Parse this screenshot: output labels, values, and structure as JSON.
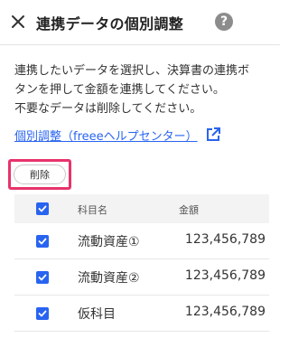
{
  "header": {
    "title": "連携データの個別調整",
    "help_symbol": "?"
  },
  "description": {
    "lines": [
      "連携したいデータを選択し、決算書の連携ボ",
      "タンを押して金額を連携してください。",
      "不要なデータは削除してください。"
    ]
  },
  "help_link": {
    "label": "個別調整（freeeヘルプセンター）"
  },
  "toolbar": {
    "delete_label": "削除"
  },
  "table": {
    "columns": {
      "name": "科目名",
      "amount": "金額"
    },
    "header_checked": true,
    "rows": [
      {
        "checked": true,
        "name": "流動資産①",
        "amount": "123,456,789"
      },
      {
        "checked": true,
        "name": "流動資産②",
        "amount": "123,456,789"
      },
      {
        "checked": true,
        "name": "仮科目",
        "amount": "123,456,789"
      }
    ]
  },
  "colors": {
    "accent": "#2864f0",
    "highlight": "#e8336b",
    "help_icon": "#8c8c8c"
  },
  "icons": {
    "close": "close-icon",
    "help": "help-icon",
    "external": "external-link-icon",
    "check": "check-icon"
  }
}
